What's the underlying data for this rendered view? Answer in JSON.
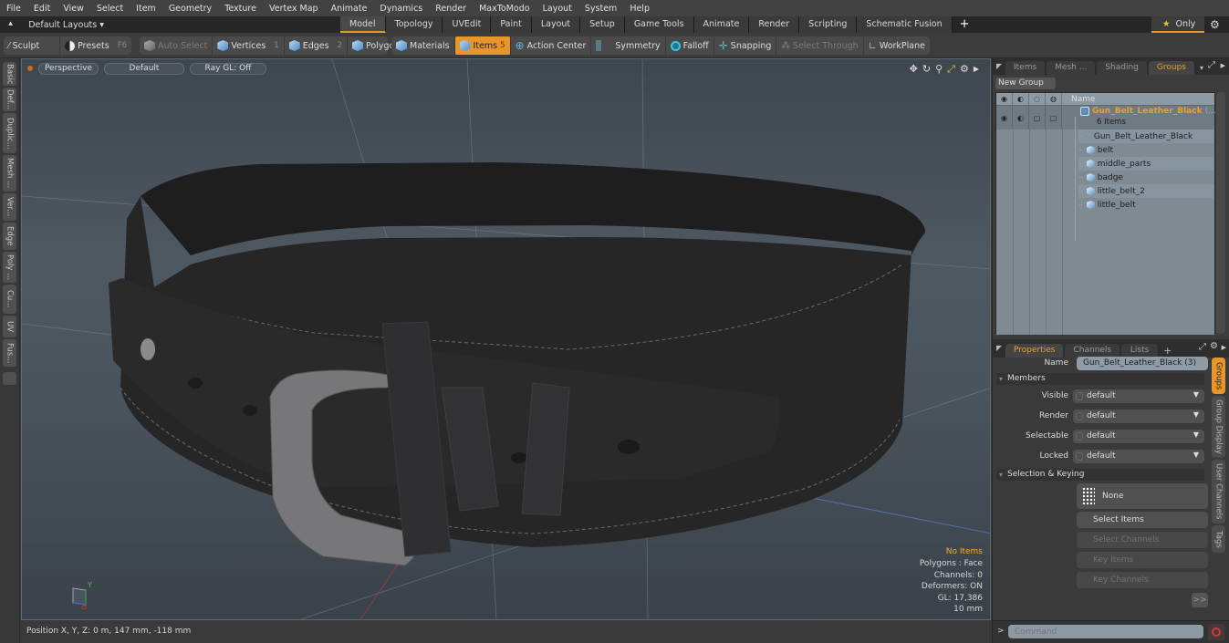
{
  "menubar": {
    "items": [
      "File",
      "Edit",
      "View",
      "Select",
      "Item",
      "Geometry",
      "Texture",
      "Vertex Map",
      "Animate",
      "Dynamics",
      "Render",
      "MaxToModo",
      "Layout",
      "System",
      "Help"
    ]
  },
  "layoutbar": {
    "layout_label": "Default Layouts ▾",
    "tabs": [
      "Model",
      "Topology",
      "UVEdit",
      "Paint",
      "Layout",
      "Setup",
      "Game Tools",
      "Animate",
      "Render",
      "Scripting",
      "Schematic Fusion"
    ],
    "active_tab": "Model",
    "add_tab": "+",
    "only_label": "Only"
  },
  "toolbar": {
    "sculpt": "Sculpt",
    "presets": "Presets",
    "presets_key": "F6",
    "auto_select": "Auto Select",
    "vertices": "Vertices",
    "vertices_key": "1",
    "edges": "Edges",
    "edges_key": "2",
    "polygons": "Polygons",
    "materials": "Materials",
    "items": "Items",
    "items_key": "5",
    "action_center": "Action Center",
    "symmetry": "Symmetry",
    "falloff": "Falloff",
    "snapping": "Snapping",
    "select_through": "Select Through",
    "workplane": "WorkPlane"
  },
  "left_tabs": [
    "Basic",
    "Def...",
    "Duplic...",
    "Mesh ...",
    "Ver...",
    "Edge",
    "Poly ...",
    "Cu...",
    "UV",
    "Fus..."
  ],
  "viewport": {
    "view_mode": "Perspective",
    "shading": "Default",
    "raygl": "Ray GL: Off",
    "hud": {
      "selection": "No Items",
      "polygons": "Polygons : Face",
      "channels": "Channels: 0",
      "deformers": "Deformers: ON",
      "gl": "GL: 17,386",
      "scale": "10 mm"
    },
    "axis_y": "Y",
    "axis_x": "X"
  },
  "status": {
    "position": "Position X, Y, Z:   0 m, 147 mm, -118 mm"
  },
  "groups_panel": {
    "tabs": [
      "Items",
      "Mesh ...",
      "Shading",
      "Groups"
    ],
    "active_tab": "Groups",
    "new_group": "New Group",
    "col_name": "Name",
    "group": {
      "name": "Gun_Belt_Leather_Black",
      "suffix": "(...",
      "count": "6 Items"
    },
    "members": [
      "Gun_Belt_Leather_Black",
      "belt",
      "middle_parts",
      "badge",
      "little_belt_2",
      "little_belt"
    ]
  },
  "properties_panel": {
    "tabs": [
      "Properties",
      "Channels",
      "Lists"
    ],
    "active_tab": "Properties",
    "add_tab": "+",
    "name_label": "Name",
    "name_value": "Gun_Belt_Leather_Black (3)",
    "members_section": "Members",
    "fields": [
      {
        "label": "Visible",
        "value": "default"
      },
      {
        "label": "Render",
        "value": "default"
      },
      {
        "label": "Selectable",
        "value": "default"
      },
      {
        "label": "Locked",
        "value": "default"
      }
    ],
    "selection_section": "Selection & Keying",
    "none_label": "None",
    "select_items": "Select Items",
    "select_channels": "Select Channels",
    "key_items": "Key Items",
    "key_channels": "Key Channels",
    "more": ">>"
  },
  "side_tabs": [
    "Groups",
    "Group Display",
    "User Channels",
    "Tags"
  ],
  "command": {
    "prompt": ">",
    "placeholder": "Command"
  },
  "colors": {
    "accent": "#e8952a",
    "highlight_text": "#f0a020"
  }
}
